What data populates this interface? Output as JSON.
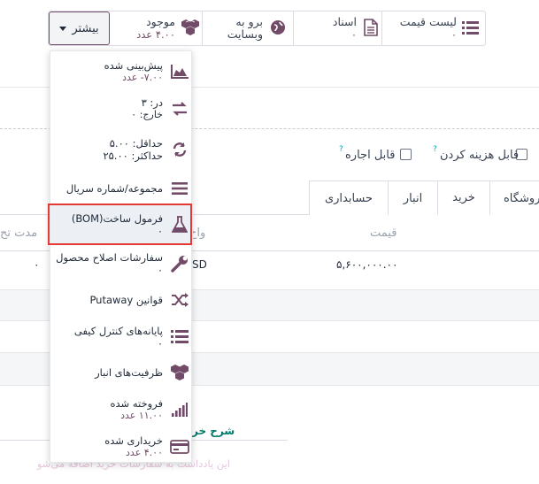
{
  "smart_buttons": [
    {
      "label": "لیست قیمت",
      "value": "۰",
      "icon": "list-icon"
    },
    {
      "label": "اسناد",
      "value": "۰",
      "icon": "document-icon"
    },
    {
      "label": "برو به",
      "label2": "وبسایت",
      "icon": "globe-icon"
    },
    {
      "label": "موجود",
      "value": "۴.۰۰ عدد",
      "icon": "cubes-icon"
    }
  ],
  "more_button": {
    "label": "بیشتر"
  },
  "checkboxes": [
    {
      "label": "قابل هزینه کردن",
      "help": "?"
    },
    {
      "label": "قابل اجاره",
      "help": "?"
    }
  ],
  "tabs": [
    {
      "label": "فروشگاه"
    },
    {
      "label": "خرید"
    },
    {
      "label": "انبار"
    },
    {
      "label": "حسابداری"
    }
  ],
  "table": {
    "headers": {
      "price": "قیمت",
      "unit": "واح",
      "lead": "مدت تح"
    },
    "row": {
      "price": "۵,۶۰۰,۰۰۰.۰۰",
      "currency": "SD",
      "lead": "۰"
    }
  },
  "footer": {
    "description_label": "شرح خر",
    "placeholder": "این یادداشت به سفارشات خرید اضافه می‌شو"
  },
  "dropdown": {
    "items": [
      {
        "label": "پیش‌بینی شده",
        "sub": "۷.۰۰- عدد",
        "icon": "area-chart-icon"
      },
      {
        "label": "در: ۳",
        "sub": "خارج: ۰",
        "icon": "exchange-icon"
      },
      {
        "label": "حداقل: ۵.۰۰",
        "sub": "حداکثر: ۲۵.۰۰",
        "icon": "refresh-icon"
      },
      {
        "label": "مجموعه/شماره سریال",
        "icon": "bars-icon"
      },
      {
        "label": "فرمول ساخت(BOM)",
        "sub": "۰",
        "icon": "flask-icon"
      },
      {
        "label": "سفارشات اصلاح محصول",
        "sub": "۰",
        "icon": "wrench-icon"
      },
      {
        "label": "قوانین Putaway",
        "icon": "random-icon"
      },
      {
        "label": "پایانه‌های کنترل کیفی",
        "sub": "۰",
        "icon": "tasks-icon"
      },
      {
        "label": "ظرفیت‌های انبار",
        "icon": "cubes-icon"
      },
      {
        "label": "فروخته شده",
        "sub": "۱۱.۰۰ عدد",
        "icon": "signal-icon"
      },
      {
        "label": "خریداری شده",
        "sub": "۴.۰۰ عدد",
        "icon": "credit-card-icon"
      }
    ]
  }
}
